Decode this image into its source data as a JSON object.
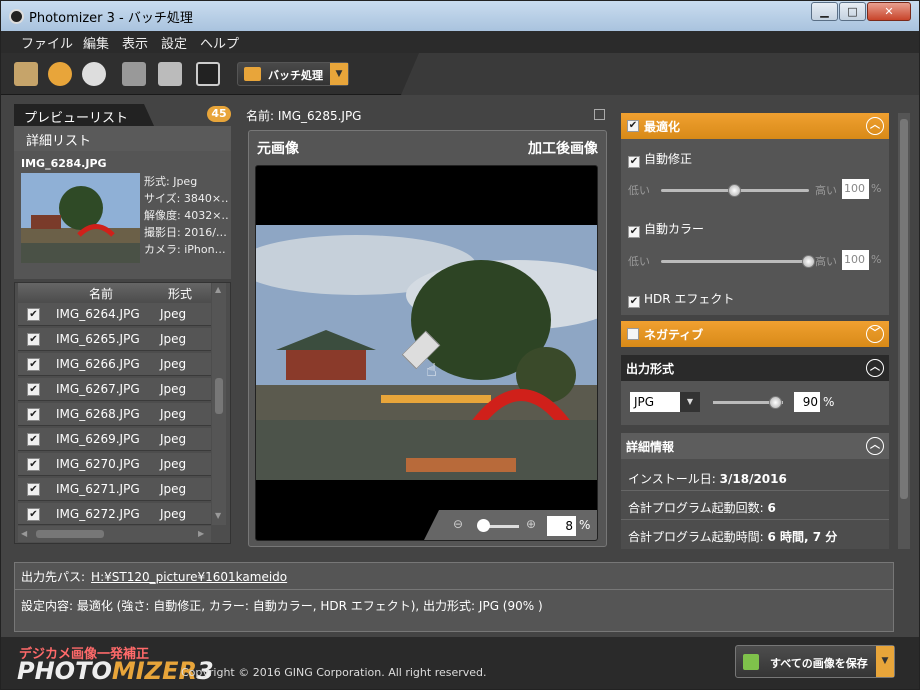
{
  "window": {
    "title": "Photomizer 3 - バッチ処理"
  },
  "menu": [
    "ファイル",
    "編集",
    "表示",
    "設定",
    "ヘルプ"
  ],
  "toolbar": {
    "batch_label": "バッチ処理"
  },
  "left": {
    "tab_preview": "プレビューリスト",
    "count": "45",
    "tab_detail": "詳細リスト",
    "file_name": "IMG_6284.JPG",
    "info": [
      "形式: Jpeg",
      "サイズ: 3840×…",
      "解像度: 4032×…",
      "撮影日: 2016/…",
      "カメラ: iPhon…"
    ],
    "col_name": "名前",
    "col_format": "形式",
    "rows": [
      {
        "name": "IMG_6264.JPG",
        "format": "Jpeg"
      },
      {
        "name": "IMG_6265.JPG",
        "format": "Jpeg"
      },
      {
        "name": "IMG_6266.JPG",
        "format": "Jpeg"
      },
      {
        "name": "IMG_6267.JPG",
        "format": "Jpeg"
      },
      {
        "name": "IMG_6268.JPG",
        "format": "Jpeg"
      },
      {
        "name": "IMG_6269.JPG",
        "format": "Jpeg"
      },
      {
        "name": "IMG_6270.JPG",
        "format": "Jpeg"
      },
      {
        "name": "IMG_6271.JPG",
        "format": "Jpeg"
      },
      {
        "name": "IMG_6272.JPG",
        "format": "Jpeg"
      }
    ]
  },
  "preview": {
    "name": "名前: IMG_6285.JPG",
    "original_label": "元画像",
    "processed_label": "加工後画像",
    "zoom": "8",
    "zoom_unit": "%"
  },
  "optimize": {
    "title": "最適化",
    "auto_fix": "自動修正",
    "low": "低い",
    "high": "高い",
    "auto_fix_value": "100",
    "auto_fix_level": 0.5,
    "auto_color": "自動カラー",
    "auto_color_value": "100",
    "auto_color_level": 1.0,
    "hdr": "HDR エフェクト",
    "pct": "%"
  },
  "negative": {
    "title": "ネガティブ"
  },
  "output_format": {
    "title": "出力形式",
    "format": "JPG",
    "quality": "90",
    "quality_level": 0.9,
    "pct": "%"
  },
  "details": {
    "title": "詳細情報",
    "install_label": "インストール日:",
    "install_value": "3/18/2016",
    "launch_count_label": "合計プログラム起動回数:",
    "launch_count_value": "6",
    "launch_time_label": "合計プログラム起動時間:",
    "launch_time_value": "6 時間, 7 分"
  },
  "output": {
    "path_label": "出力先パス:",
    "path": "H:¥ST120_picture¥1601kameido",
    "settings": "設定内容: 最適化 (強さ: 自動修正, カラー: 自動カラー, HDR エフェクト), 出力形式: JPG (90% )"
  },
  "footer": {
    "logo_tagline": "デジカメ画像一発補正",
    "logo_main": "PHOTO",
    "logo_accent": "MIZER",
    "logo_num": "3",
    "copyright": "Copyright © 2016 GING Corporation. All right reserved.",
    "save_all": "すべての画像を保存"
  }
}
